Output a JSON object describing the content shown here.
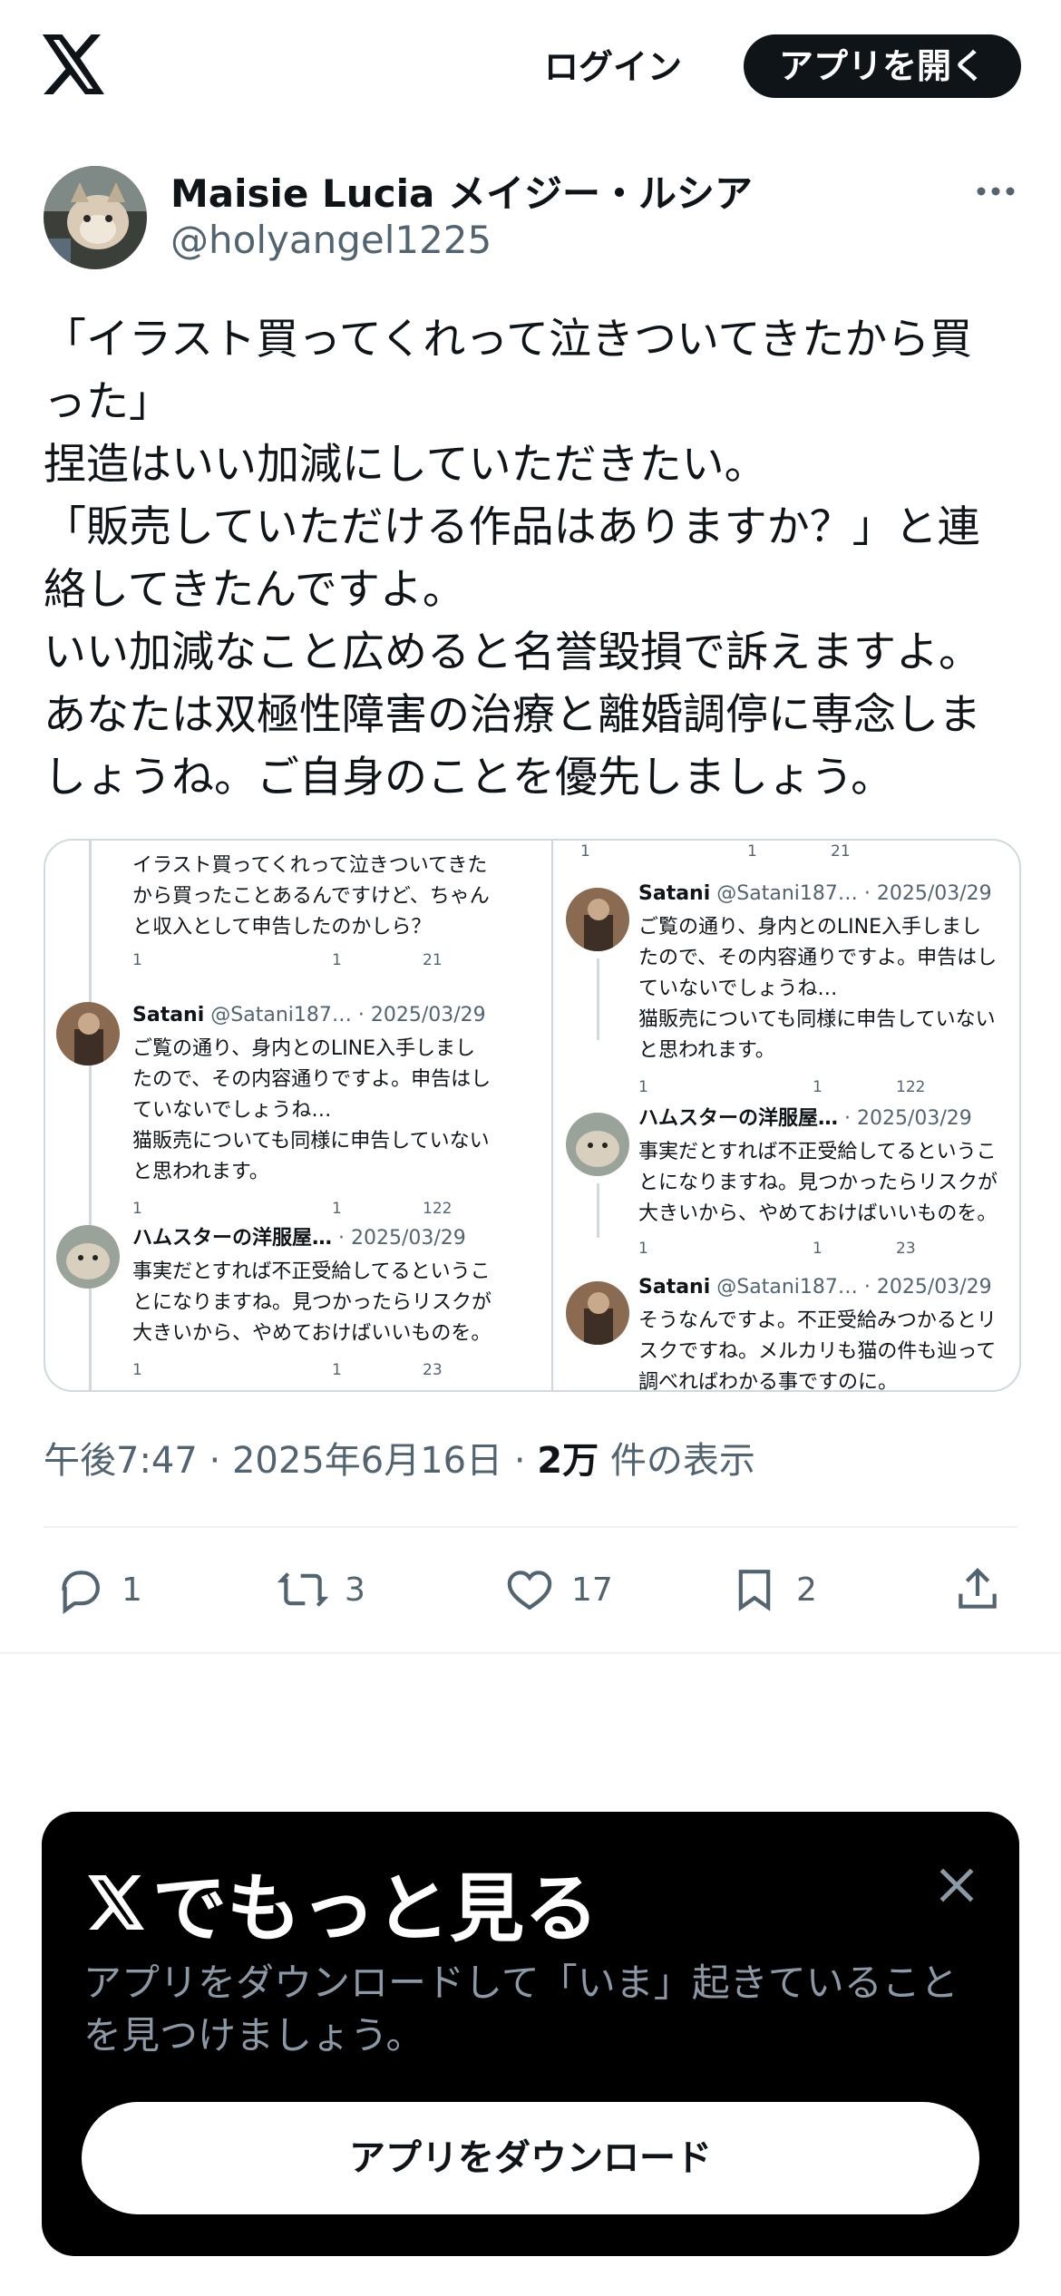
{
  "header": {
    "logo_icon": "x-logo-icon",
    "login_label": "ログイン",
    "open_app_label": "アプリを開く"
  },
  "post": {
    "display_name": "Maisie Lucia メイジー・ルシア",
    "handle": "@holyangel1225",
    "text_lines": [
      "「イラスト買ってくれって泣きついてきたから買",
      "った」",
      "捏造はいい加減にしていただきたい。",
      "「販売していただける作品はありますか？」と連",
      "絡してきたんですよ。",
      "いい加減なこと広めると名誉毀損で訴えますよ。",
      "あなたは双極性障害の治療と離婚調停に専念しま",
      "しょうね。ご自身のことを優先しましょう。"
    ],
    "time": "午後7:47",
    "date": "2025年6月16日",
    "views_count": "2万",
    "views_label": "件の表示",
    "actions": {
      "reply_count": "1",
      "retweet_count": "3",
      "like_count": "17",
      "bookmark_count": "2"
    }
  },
  "media": {
    "left": {
      "first_text": [
        "イラスト買ってくれって泣きついてきた",
        "から買ったことあるんですけど、ちゃん",
        "と収入として申告したのかしら？"
      ],
      "first_metrics": [
        "1",
        "",
        "1",
        "21"
      ],
      "satani_name": "Satani",
      "satani_meta": "@Satani187… · 2025/03/29",
      "satani_text": [
        "ご覧の通り、身内とのLINE入手しまし",
        "たので、その内容通りですよ。申告はし",
        "ていないでしょうね…",
        "猫販売についても同様に申告していない",
        "と思われます。"
      ],
      "satani_metrics": [
        "1",
        "",
        "1",
        "122"
      ],
      "hamster_name": "ハムスターの洋服屋…",
      "hamster_meta": "· 2025/03/29",
      "hamster_text": [
        "事実だとすれば不正受給してるというこ",
        "とになりますね。見つかったらリスクが",
        "大きいから、やめておけばいいものを。"
      ],
      "hamster_metrics": [
        "1",
        "",
        "1",
        "23"
      ]
    },
    "right": {
      "top_metrics": [
        "1",
        "",
        "1",
        "21"
      ],
      "satani_name": "Satani",
      "satani_meta": "@Satani187… · 2025/03/29",
      "satani_text": [
        "ご覧の通り、身内とのLINE入手しまし",
        "たので、その内容通りですよ。申告はし",
        "ていないでしょうね…",
        "猫販売についても同様に申告していない",
        "と思われます。"
      ],
      "satani_metrics": [
        "1",
        "",
        "1",
        "122"
      ],
      "hamster_name": "ハムスターの洋服屋…",
      "hamster_meta": "· 2025/03/29",
      "hamster_text": [
        "事実だとすれば不正受給してるというこ",
        "とになりますね。見つかったらリスクが",
        "大きいから、やめておけばいいものを。"
      ],
      "hamster_metrics": [
        "1",
        "",
        "1",
        "23"
      ],
      "satani2_name": "Satani",
      "satani2_meta": "@Satani187… · 2025/03/29",
      "satani2_text": [
        "そうなんですよ。不正受給みつかるとリ",
        "スクですね。メルカリも猫の件も辿って",
        "調べればわかる事ですのに。"
      ]
    }
  },
  "promo": {
    "title_suffix": "でもっと見る",
    "description_lines": [
      "アプリをダウンロードして「いま」起きていること",
      "を見つけましょう。"
    ],
    "download_label": "アプリをダウンロード"
  },
  "colors": {
    "text_primary": "#0f1419",
    "text_secondary": "#536471",
    "border": "#cfd9de",
    "promo_bg": "#000000",
    "promo_desc": "#8b98a5"
  }
}
